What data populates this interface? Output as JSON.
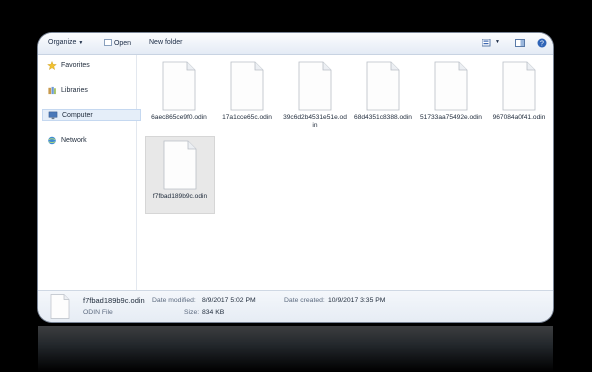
{
  "toolbar": {
    "organize": "Organize",
    "open": "Open",
    "new_folder": "New folder"
  },
  "sidebar": {
    "items": [
      {
        "label": "Favorites"
      },
      {
        "label": "Libraries"
      },
      {
        "label": "Computer"
      },
      {
        "label": "Network"
      }
    ]
  },
  "files": [
    {
      "name": "6aec865ce9f0.odin"
    },
    {
      "name": "17a1cce65c.odin"
    },
    {
      "name": "39c6d2b4531e51e.odin"
    },
    {
      "name": "68d4351c8388.odin"
    },
    {
      "name": "51733aa75492e.odin"
    },
    {
      "name": "967084a0f41.odin"
    },
    {
      "name": "f7fbad189b9c.odin"
    }
  ],
  "details": {
    "filename": "f7fbad189b9c.odin",
    "filetype": "ODIN File",
    "modified_label": "Date modified:",
    "modified_value": "8/9/2017 5:02 PM",
    "size_label": "Size:",
    "size_value": "834 KB",
    "created_label": "Date created:",
    "created_value": "10/9/2017 3:35 PM"
  },
  "colors": {
    "background": "#000000",
    "window": "#ffffff",
    "selection": "#e5eef9"
  }
}
